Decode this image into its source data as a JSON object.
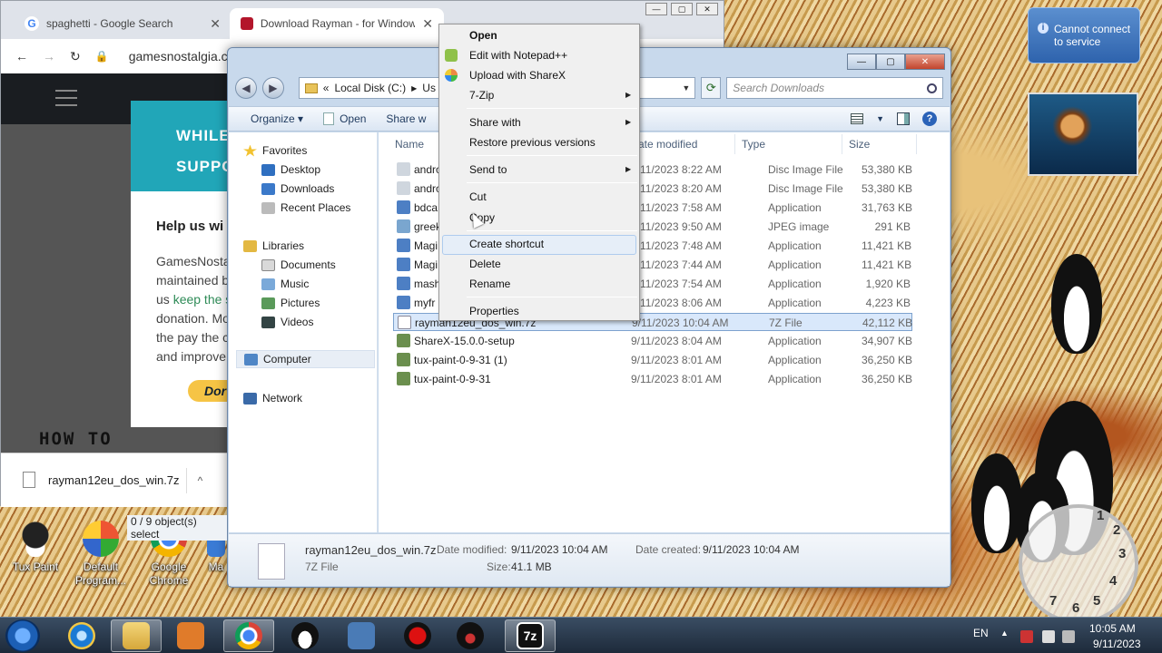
{
  "chrome": {
    "tabs": [
      {
        "title": "spaghetti - Google Search",
        "close": "✕"
      },
      {
        "title": "Download Rayman - for Window",
        "close": "✕"
      }
    ],
    "url": "gamesnostalgia.c",
    "site": {
      "banner_line1": "WHILE",
      "banner_line2": "SUPPO",
      "card_heading": "Help us wi",
      "card_lines": [
        "GamesNosta",
        "maintained b",
        "donation. Mo",
        "the pay the c",
        "and improve"
      ],
      "card_us": "us",
      "card_keep": "keep the s",
      "donate": "Dor",
      "how_to": "HOW TO"
    },
    "download": {
      "file": "rayman12eu_dos_win.7z",
      "chevron": "^"
    }
  },
  "explorer": {
    "breadcrumb_prefix": "«",
    "breadcrumb_drive": "Local Disk (C:)",
    "breadcrumb_next": "Us",
    "search_placeholder": "Search Downloads",
    "toolbar": {
      "organize": "Organize ▾",
      "open": "Open",
      "share": "Share w"
    },
    "nav": {
      "favorites": "Favorites",
      "desktop": "Desktop",
      "downloads": "Downloads",
      "recent": "Recent Places",
      "libraries": "Libraries",
      "documents": "Documents",
      "music": "Music",
      "pictures": "Pictures",
      "videos": "Videos",
      "computer": "Computer",
      "network": "Network"
    },
    "columns": {
      "name": "Name",
      "date": "ate modified",
      "type": "Type",
      "size": "Size"
    },
    "files": [
      {
        "name": "andro",
        "date": "9/11/2023 8:22 AM",
        "type": "Disc Image File",
        "size": "53,380 KB",
        "icon": "disc-image-icon"
      },
      {
        "name": "andro",
        "date": "9/11/2023 8:20 AM",
        "type": "Disc Image File",
        "size": "53,380 KB",
        "icon": "disc-image-icon"
      },
      {
        "name": "bdca",
        "date": "9/11/2023 7:58 AM",
        "type": "Application",
        "size": "31,763 KB",
        "icon": "app-icon"
      },
      {
        "name": "greek",
        "date": "9/11/2023 9:50 AM",
        "type": "JPEG image",
        "size": "291 KB",
        "icon": "image-icon"
      },
      {
        "name": "Magi",
        "date": "9/11/2023 7:48 AM",
        "type": "Application",
        "size": "11,421 KB",
        "icon": "app-icon"
      },
      {
        "name": "Magi",
        "date": "9/11/2023 7:44 AM",
        "type": "Application",
        "size": "11,421 KB",
        "icon": "app-icon"
      },
      {
        "name": "mash",
        "date": "9/11/2023 7:54 AM",
        "type": "Application",
        "size": "1,920 KB",
        "icon": "app-icon"
      },
      {
        "name": "myfr",
        "date": "9/11/2023 8:06 AM",
        "type": "Application",
        "size": "4,223 KB",
        "icon": "app-icon"
      },
      {
        "name": "rayman12eu_dos_win.7z",
        "date": "9/11/2023 10:04 AM",
        "type": "7Z File",
        "size": "42,112 KB",
        "icon": "archive-icon"
      },
      {
        "name": "ShareX-15.0.0-setup",
        "date": "9/11/2023 8:04 AM",
        "type": "Application",
        "size": "34,907 KB",
        "icon": "installer-icon"
      },
      {
        "name": "tux-paint-0-9-31 (1)",
        "date": "9/11/2023 8:01 AM",
        "type": "Application",
        "size": "36,250 KB",
        "icon": "installer-icon"
      },
      {
        "name": "tux-paint-0-9-31",
        "date": "9/11/2023 8:01 AM",
        "type": "Application",
        "size": "36,250 KB",
        "icon": "installer-icon"
      }
    ],
    "details": {
      "filename": "rayman12eu_dos_win.7z",
      "filetype": "7Z File",
      "modified_label": "Date modified:",
      "modified": "9/11/2023 10:04 AM",
      "created_label": "Date created:",
      "created": "9/11/2023 10:04 AM",
      "size_label": "Size:",
      "size": "41.1 MB"
    },
    "status": "0 / 9 object(s) select"
  },
  "context_menu": {
    "open": "Open",
    "edit_notepad": "Edit with Notepad++",
    "sharex": "Upload with ShareX",
    "zip": "7-Zip",
    "share_with": "Share with",
    "restore": "Restore previous versions",
    "send_to": "Send to",
    "cut": "Cut",
    "copy": "Copy",
    "create_shortcut": "Create shortcut",
    "delete": "Delete",
    "rename": "Rename",
    "properties": "Properties"
  },
  "gadget": {
    "notice": "Cannot connect\nto service",
    "clock_numbers": [
      "3",
      "4",
      "5",
      "6",
      "7",
      "2",
      "1"
    ]
  },
  "desktop": {
    "icons": [
      "Tux Paint",
      "Default Program...",
      "Google Chrome",
      "Ma"
    ]
  },
  "tray": {
    "lang": "EN",
    "time": "10:05 AM",
    "date": "9/11/2023"
  }
}
